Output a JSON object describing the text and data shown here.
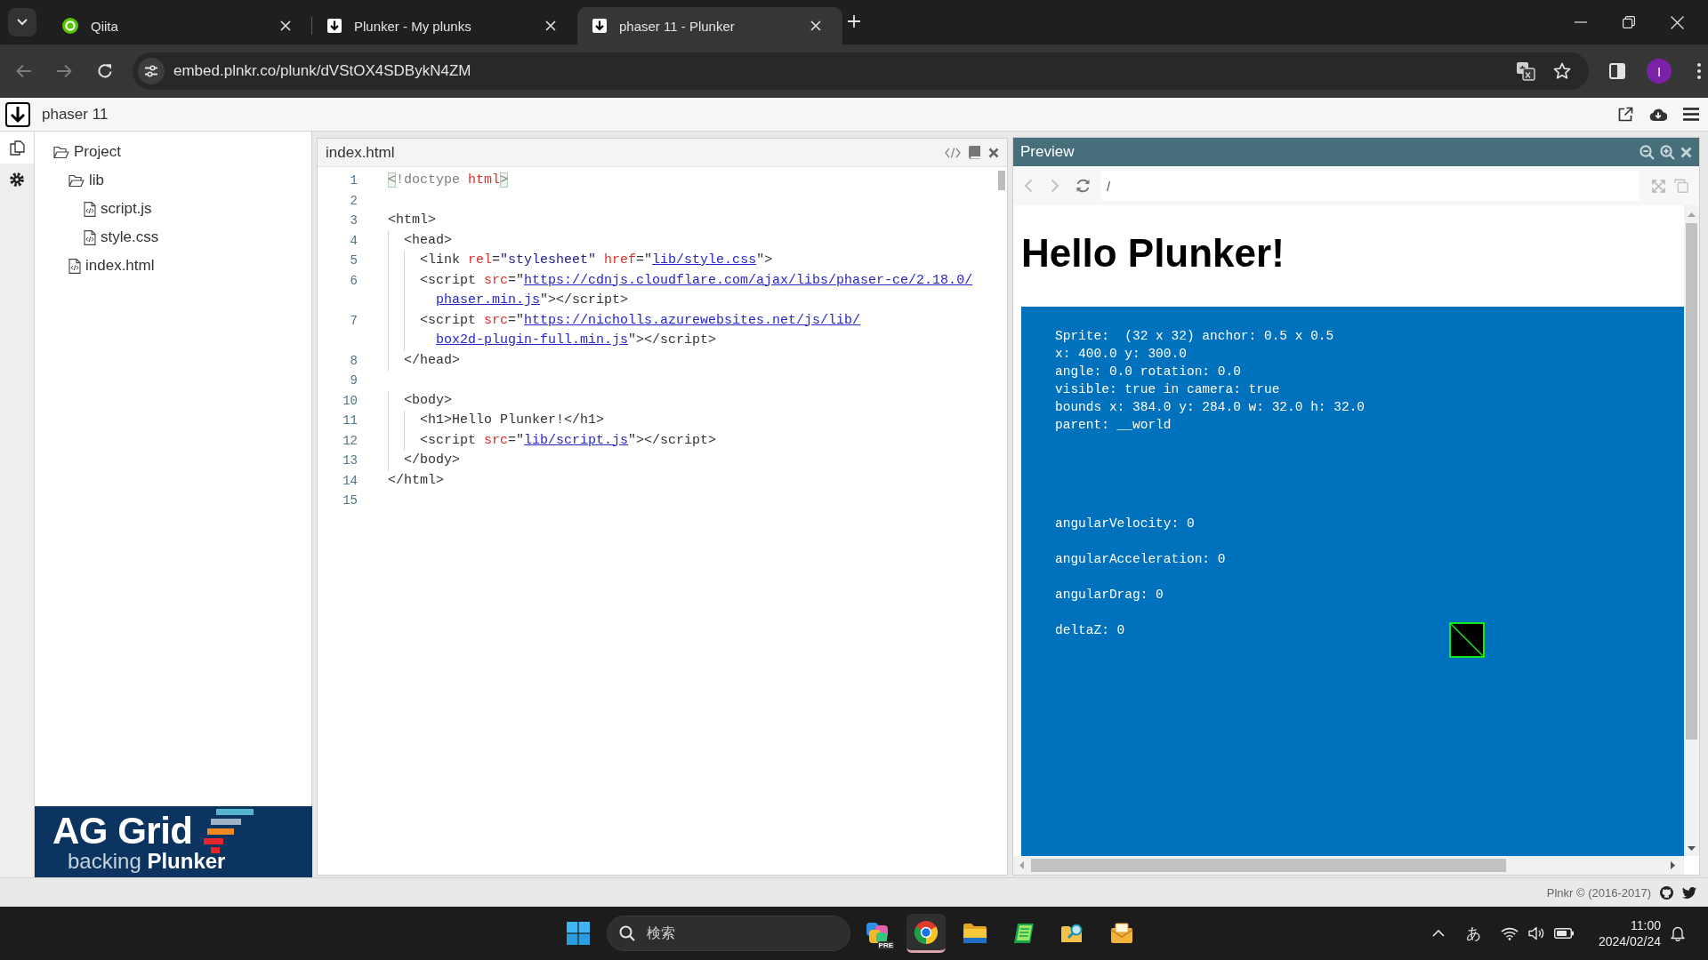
{
  "browser": {
    "tabs": [
      {
        "title": "Qiita",
        "kind": "ring",
        "selected": false
      },
      {
        "title": "Plunker - My plunks",
        "kind": "arrow",
        "selected": false
      },
      {
        "title": "phaser 11 - Plunker",
        "kind": "arrow",
        "selected": true
      }
    ],
    "nav_buttons": [
      {
        "kind": "back",
        "disabled": true
      },
      {
        "kind": "forward",
        "disabled": true
      },
      {
        "kind": "reload",
        "disabled": false
      }
    ],
    "url": "embed.plnkr.co/plunk/dVStOX4SDBykN4ZM",
    "profile_initial": "I"
  },
  "plunker": {
    "title": "phaser 11",
    "rail": [
      {
        "kind": "files",
        "selected": true
      },
      {
        "kind": "settings",
        "selected": false
      }
    ],
    "tree": [
      {
        "name": "Project",
        "kind": "folder",
        "expanded": true,
        "children": [
          {
            "name": "lib",
            "kind": "folder",
            "expanded": true,
            "children": [
              {
                "name": "script.js",
                "kind": "file"
              },
              {
                "name": "style.css",
                "kind": "file"
              }
            ]
          },
          {
            "name": "index.html",
            "kind": "file"
          }
        ]
      }
    ],
    "banner": {
      "title": "AG Grid",
      "tagline": "backing **Plunker**"
    },
    "editor": {
      "filename": "index.html",
      "lines": [
        {
          "number": "1",
          "tokens": [
            {
              "kind": "bracket",
              "text": "<"
            },
            {
              "kind": "meta",
              "text": "!doctype "
            },
            {
              "kind": "attr",
              "text": "html"
            },
            {
              "kind": "bracket",
              "text": ">"
            }
          ]
        },
        {
          "number": "2"
        },
        {
          "number": "3",
          "tokens": [
            {
              "kind": "plain",
              "text": "<html>"
            }
          ]
        },
        {
          "number": "4",
          "tokens": [
            {
              "kind": "plain",
              "text": "  <head>"
            }
          ]
        },
        {
          "number": "5",
          "tokens": [
            {
              "kind": "plain",
              "text": "    <link "
            },
            {
              "kind": "attr",
              "text": "rel"
            },
            {
              "kind": "plain",
              "text": "="
            },
            {
              "kind": "string",
              "text": "\"stylesheet\""
            },
            {
              "kind": "attr",
              "text": " href"
            },
            {
              "kind": "plain",
              "text": "=\""
            },
            {
              "kind": "link",
              "text": "lib/style.css"
            },
            {
              "kind": "plain",
              "text": "\">"
            }
          ]
        },
        {
          "number": "6",
          "tokens": [
            {
              "kind": "plain",
              "text": "    <script "
            },
            {
              "kind": "attr",
              "text": "src"
            },
            {
              "kind": "plain",
              "text": "=\""
            },
            {
              "kind": "link",
              "text": "https://cdnjs.cloudflare.com/ajax/libs/phaser-ce/2.18.0/"
            }
          ],
          "continuation": [
            {
              "kind": "link",
              "text": "phaser.min.js"
            },
            {
              "kind": "plain",
              "text": "\"></script>"
            }
          ]
        },
        {
          "number": "7",
          "tokens": [
            {
              "kind": "plain",
              "text": "    <script "
            },
            {
              "kind": "attr",
              "text": "src"
            },
            {
              "kind": "plain",
              "text": "=\""
            },
            {
              "kind": "link",
              "text": "https://nicholls.azurewebsites.net/js/lib/"
            }
          ],
          "continuation": [
            {
              "kind": "link",
              "text": "box2d-plugin-full.min.js"
            },
            {
              "kind": "plain",
              "text": "\"></script>"
            }
          ]
        },
        {
          "number": "8",
          "tokens": [
            {
              "kind": "plain",
              "text": "  </head>"
            }
          ]
        },
        {
          "number": "9"
        },
        {
          "number": "10",
          "tokens": [
            {
              "kind": "plain",
              "text": "  <body>"
            }
          ]
        },
        {
          "number": "11",
          "tokens": [
            {
              "kind": "plain",
              "text": "    <h1>Hello Plunker!</h1>"
            }
          ]
        },
        {
          "number": "12",
          "tokens": [
            {
              "kind": "plain",
              "text": "    <script "
            },
            {
              "kind": "attr",
              "text": "src"
            },
            {
              "kind": "plain",
              "text": "=\""
            },
            {
              "kind": "link",
              "text": "lib/script.js"
            },
            {
              "kind": "plain",
              "text": "\"></script>"
            }
          ]
        },
        {
          "number": "13",
          "tokens": [
            {
              "kind": "plain",
              "text": "  </body>"
            }
          ]
        },
        {
          "number": "14",
          "tokens": [
            {
              "kind": "plain",
              "text": "</html>"
            }
          ]
        },
        {
          "number": "15"
        }
      ]
    },
    "preview": {
      "title": "Preview",
      "path": "/",
      "heading": "Hello Plunker!",
      "canvas": {
        "info_lines": [
          "Sprite:  (32 x 32) anchor: 0.5 x 0.5",
          "x: 400.0 y: 300.0",
          "angle: 0.0 rotation: 0.0",
          "visible: true in camera: true",
          "bounds x: 384.0 y: 284.0 w: 32.0 h: 32.0",
          "parent: __world"
        ],
        "physics_lines": [
          "angularVelocity: 0",
          "angularAcceleration: 0",
          "angularDrag: 0",
          "deltaZ: 0"
        ]
      }
    },
    "footer": "Plnkr © (2016-2017)"
  },
  "taskbar": {
    "search_placeholder": "検索",
    "apps": [
      {
        "kind": "tiles",
        "badge": "PRE",
        "selected": false
      },
      {
        "kind": "browser",
        "selected": true
      },
      {
        "kind": "folder",
        "selected": false
      },
      {
        "kind": "notebook",
        "selected": false
      },
      {
        "kind": "finder",
        "selected": false
      },
      {
        "kind": "envelope",
        "selected": false
      }
    ],
    "ime": "あ",
    "time": "11:00",
    "date": "2024/02/24"
  }
}
